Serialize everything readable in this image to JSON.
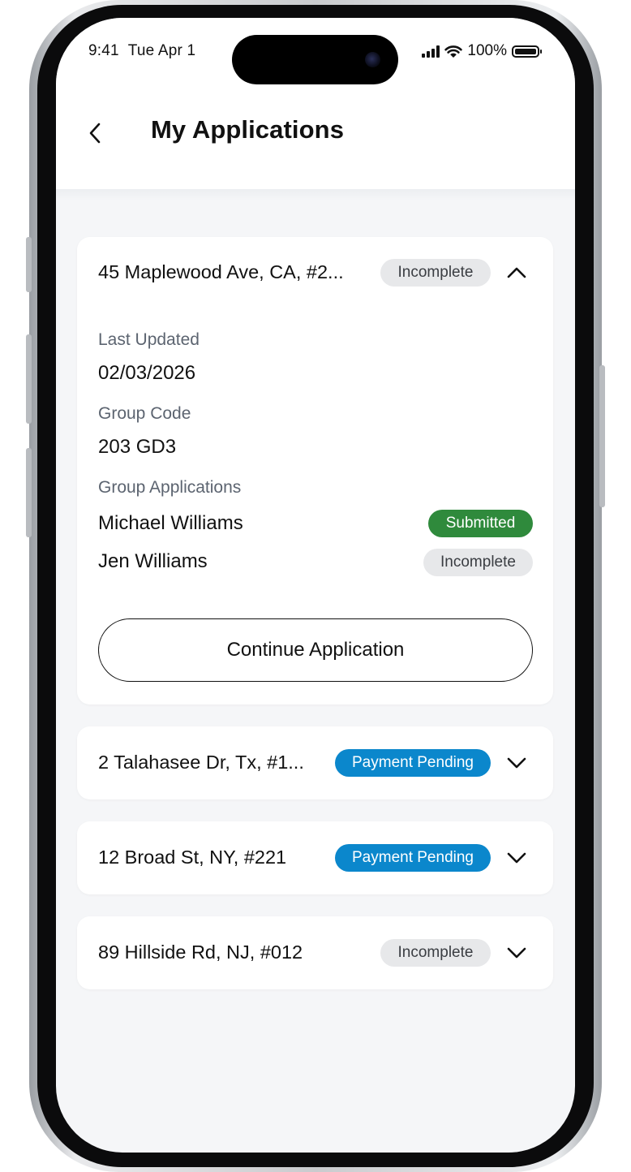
{
  "status_bar": {
    "time": "9:41",
    "date": "Tue Apr 1",
    "battery": "100%"
  },
  "header": {
    "title": "My Applications",
    "back_icon": "chevron-left-icon"
  },
  "applications": [
    {
      "title": "45 Maplewood Ave, CA, #2...",
      "status": "Incomplete",
      "expanded": true,
      "details": {
        "last_updated_label": "Last Updated",
        "last_updated_value": "02/03/2026",
        "group_code_label": "Group Code",
        "group_code_value": "203 GD3",
        "group_applications_label": "Group Applications",
        "members": [
          {
            "name": "Michael Williams",
            "status": "Submitted"
          },
          {
            "name": "Jen Williams",
            "status": "Incomplete"
          }
        ],
        "continue_label": "Continue Application"
      }
    },
    {
      "title": "2 Talahasee Dr, Tx, #1...",
      "status": "Payment Pending",
      "expanded": false
    },
    {
      "title": "12 Broad St, NY, #221",
      "status": "Payment Pending",
      "expanded": false
    },
    {
      "title": "89 Hillside Rd, NJ, #012",
      "status": "Incomplete",
      "expanded": false
    }
  ],
  "colors": {
    "incomplete": "#e7e8ea",
    "payment_pending": "#0b87cc",
    "submitted": "#2f8a3c",
    "background": "#f5f6f8"
  }
}
